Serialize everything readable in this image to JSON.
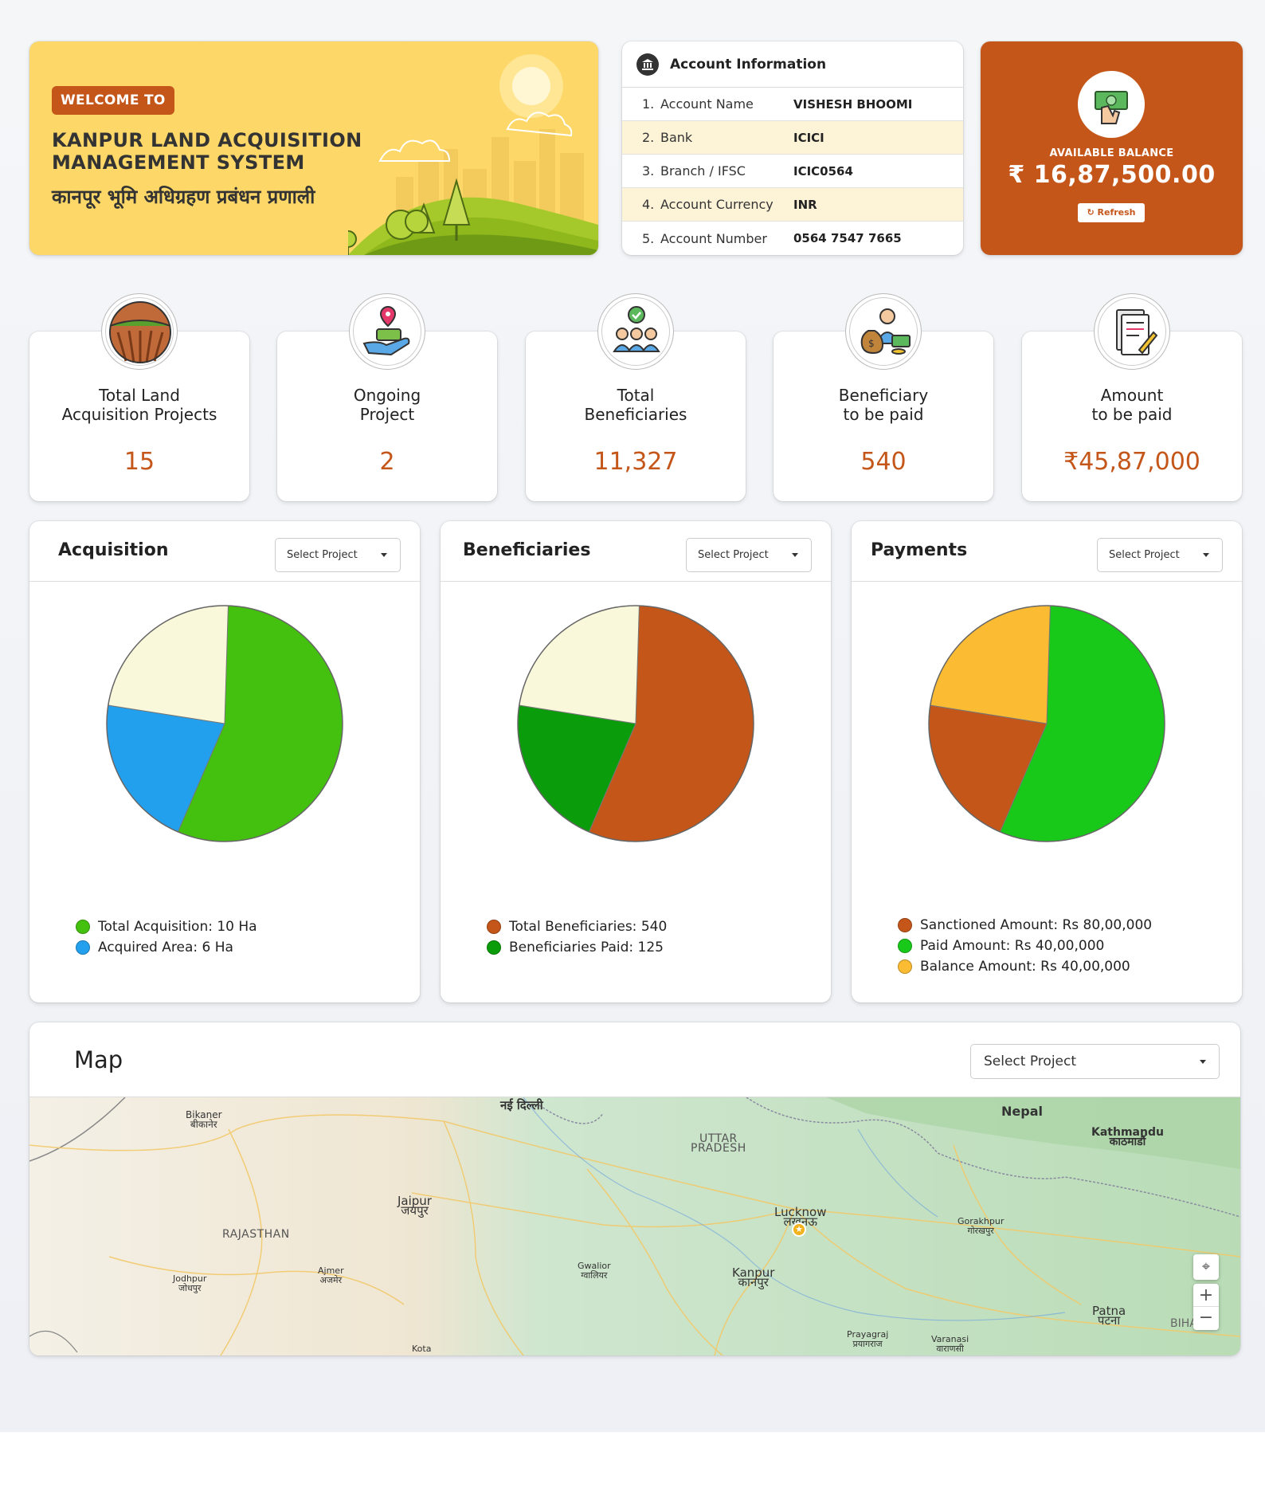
{
  "welcome": {
    "badge": "WELCOME TO",
    "title": "KANPUR LAND ACQUISITION MANAGEMENT SYSTEM",
    "title_hindi": "कानपूर भूमि अधिग्रहण प्रबंधन प्रणाली"
  },
  "account": {
    "title": "Account Information",
    "rows": [
      {
        "num": "1.",
        "label": "Account Name",
        "value": "VISHESH BHOOMI"
      },
      {
        "num": "2.",
        "label": "Bank",
        "value": "ICICI"
      },
      {
        "num": "3.",
        "label": "Branch / IFSC",
        "value": "ICIC0564"
      },
      {
        "num": "4.",
        "label": "Account Currency",
        "value": "INR"
      },
      {
        "num": "5.",
        "label": "Account Number",
        "value": "0564 7547 7665"
      }
    ]
  },
  "balance": {
    "label": "AVAILABLE BALANCE",
    "amount": "₹ 16,87,500.00",
    "refresh": "Refresh",
    "accent": "#c4561a"
  },
  "stats": [
    {
      "line1": "Total Land",
      "line2": "Acquisition Projects",
      "value": "15",
      "icon": "farmland-icon"
    },
    {
      "line1": "Ongoing",
      "line2": "Project",
      "value": "2",
      "icon": "land-in-hand-icon"
    },
    {
      "line1": "Total",
      "line2": "Beneficiaries",
      "value": "11,327",
      "icon": "group-check-icon"
    },
    {
      "line1": "Beneficiary",
      "line2": "to be paid",
      "value": "540",
      "icon": "money-bag-person-icon"
    },
    {
      "line1": "Amount",
      "line2": "to be paid",
      "value": "₹45,87,000",
      "icon": "document-sign-icon"
    }
  ],
  "panels": [
    {
      "title": "Acquisition",
      "select": "Select Project"
    },
    {
      "title": "Beneficiaries",
      "select": "Select Project"
    },
    {
      "title": "Payments",
      "select": "Select Project"
    }
  ],
  "chart_data": [
    {
      "type": "pie",
      "labels": [
        "Total Acquisition",
        "Acquired Area",
        "Remaining"
      ],
      "legend": [
        "Total Acquisition: 10 Ha",
        "Acquired Area: 6 Ha"
      ],
      "values": [
        56,
        21,
        23
      ],
      "colors": [
        "#44c10f",
        "#22a0ee",
        "#f9f8da"
      ]
    },
    {
      "type": "pie",
      "labels": [
        "Total Beneficiaries",
        "Beneficiaries Paid",
        "Remaining"
      ],
      "legend": [
        "Total Beneficiaries: 540",
        "Beneficiaries Paid: 125"
      ],
      "values": [
        56,
        21,
        23
      ],
      "colors": [
        "#c4561a",
        "#0a9c0a",
        "#f9f8da"
      ]
    },
    {
      "type": "pie",
      "labels": [
        "Paid Amount",
        "Sanctioned Amount",
        "Balance Amount"
      ],
      "legend": [
        "Sanctioned Amount: Rs 80,00,000",
        "Paid Amount: Rs 40,00,000",
        "Balance Amount: Rs 40,00,000"
      ],
      "legend_colors": [
        "#c4561a",
        "#19c919",
        "#fbbb32"
      ],
      "values": [
        56,
        21,
        23
      ],
      "colors": [
        "#19c919",
        "#c4561a",
        "#fbbb32"
      ]
    }
  ],
  "map": {
    "title": "Map",
    "select": "Select Project",
    "places": [
      {
        "name": "Bikaner",
        "hindi": "बीकानेर"
      },
      {
        "name": "नई दिल्ली",
        "hindi": ""
      },
      {
        "name": "UTTAR",
        "hindi": "PRADESH"
      },
      {
        "name": "Nepal",
        "hindi": ""
      },
      {
        "name": "Kathmandu",
        "hindi": "काठमाडौं"
      },
      {
        "name": "Jaipur",
        "hindi": "जयपुर"
      },
      {
        "name": "RAJASTHAN",
        "hindi": ""
      },
      {
        "name": "Lucknow",
        "hindi": "लखनऊ"
      },
      {
        "name": "Gorakhpur",
        "hindi": "गोरखपुर"
      },
      {
        "name": "Jodhpur",
        "hindi": "जोधपुर"
      },
      {
        "name": "Ajmer",
        "hindi": "अजमेर"
      },
      {
        "name": "Gwalior",
        "hindi": "ग्वालियर"
      },
      {
        "name": "Kanpur",
        "hindi": "कानपुर"
      },
      {
        "name": "Patna",
        "hindi": "पटना"
      },
      {
        "name": "Prayagraj",
        "hindi": "प्रयागराज"
      },
      {
        "name": "Varanasi",
        "hindi": "वाराणसी"
      },
      {
        "name": "Kota",
        "hindi": ""
      },
      {
        "name": "BIHA",
        "hindi": ""
      }
    ],
    "zoom_in": "+",
    "zoom_out": "−"
  }
}
